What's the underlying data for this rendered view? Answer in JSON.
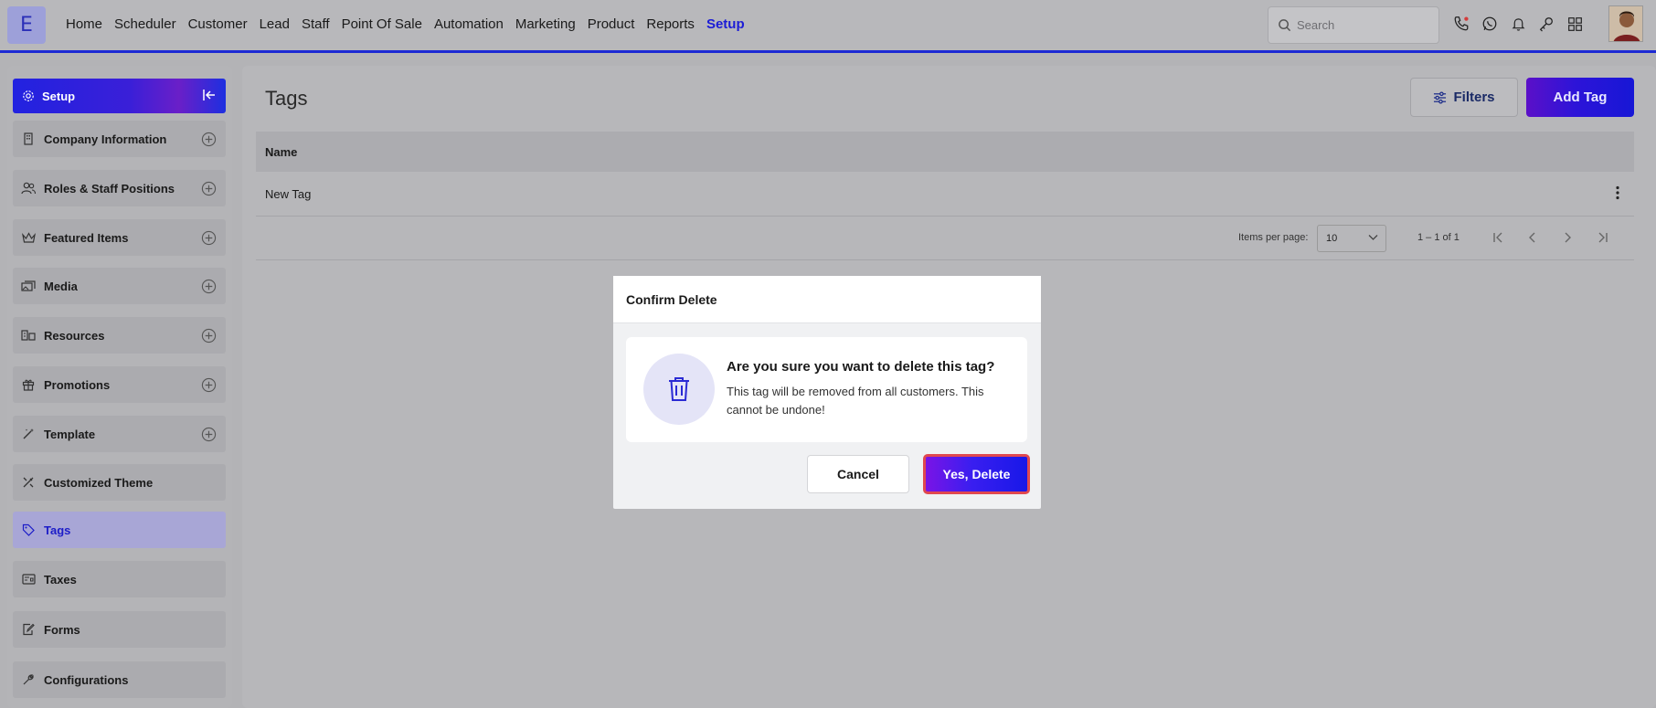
{
  "app": {
    "logo_letter": "E"
  },
  "nav": {
    "items": [
      "Home",
      "Scheduler",
      "Customer",
      "Lead",
      "Staff",
      "Point Of Sale",
      "Automation",
      "Marketing",
      "Product",
      "Reports",
      "Setup"
    ],
    "active": "Setup"
  },
  "search": {
    "placeholder": "Search"
  },
  "top_icons": [
    "phone-call-icon",
    "whatsapp-icon",
    "bell-icon",
    "key-icon",
    "apps-grid-icon"
  ],
  "sidebar": {
    "header": "Setup",
    "items": [
      {
        "label": "Company Information",
        "icon": "building-icon",
        "expandable": true
      },
      {
        "label": "Roles & Staff Positions",
        "icon": "users-icon",
        "expandable": true
      },
      {
        "label": "Featured Items",
        "icon": "crown-icon",
        "expandable": true
      },
      {
        "label": "Media",
        "icon": "media-icon",
        "expandable": true
      },
      {
        "label": "Resources",
        "icon": "resources-icon",
        "expandable": true
      },
      {
        "label": "Promotions",
        "icon": "gift-icon",
        "expandable": true
      },
      {
        "label": "Template",
        "icon": "magic-wand-icon",
        "expandable": true
      },
      {
        "label": "Customized Theme",
        "icon": "theme-icon",
        "expandable": false
      },
      {
        "label": "Tags",
        "icon": "tag-icon",
        "expandable": false,
        "active": true
      },
      {
        "label": "Taxes",
        "icon": "taxes-icon",
        "expandable": false
      },
      {
        "label": "Forms",
        "icon": "form-icon",
        "expandable": false
      },
      {
        "label": "Configurations",
        "icon": "wrench-icon",
        "expandable": false
      }
    ]
  },
  "main": {
    "title": "Tags",
    "filters_label": "Filters",
    "add_label": "Add Tag",
    "table": {
      "columns": [
        "Name"
      ],
      "rows": [
        [
          "New Tag"
        ]
      ]
    },
    "pagination": {
      "items_per_page_label": "Items per page:",
      "items_per_page": "10",
      "range": "1 – 1 of 1"
    }
  },
  "modal": {
    "title": "Confirm Delete",
    "question": "Are you sure you want to delete this tag?",
    "description": "This tag will be removed from all customers. This cannot be undone!",
    "cancel_label": "Cancel",
    "confirm_label": "Yes, Delete"
  },
  "colors": {
    "accent": "#1c1cd6",
    "danger_outline": "#e0484f",
    "overlay": "#b3b3b6"
  }
}
